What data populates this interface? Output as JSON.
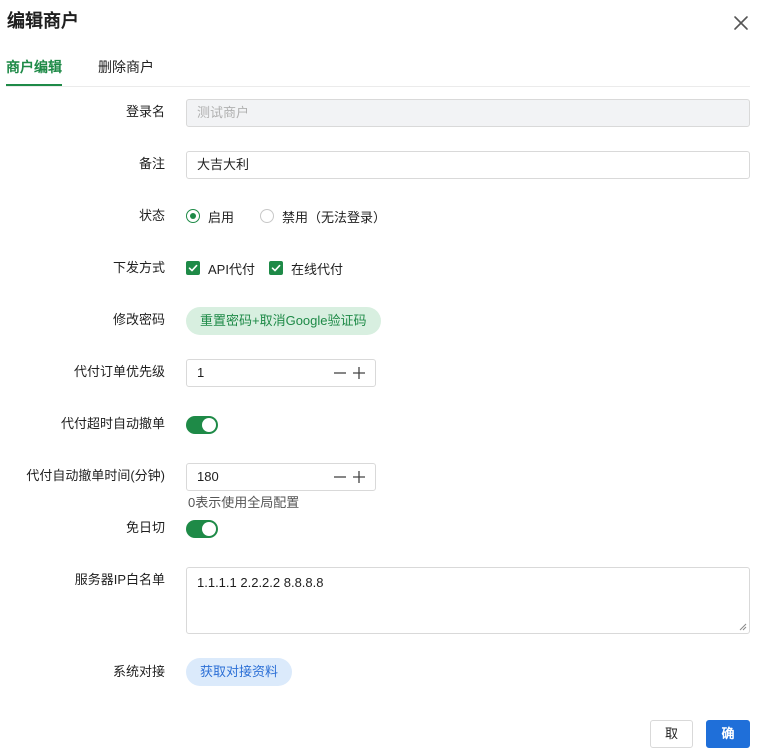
{
  "dialog": {
    "title": "编辑商户"
  },
  "tabs": [
    {
      "label": "商户编辑",
      "active": true
    },
    {
      "label": "删除商户",
      "active": false
    }
  ],
  "form": {
    "login_name": {
      "label": "登录名",
      "placeholder": "测试商户"
    },
    "remark": {
      "label": "备注",
      "value": "大吉大利"
    },
    "status": {
      "label": "状态",
      "options": [
        "启用",
        "禁用（无法登录）"
      ],
      "selected": "启用"
    },
    "dispatch": {
      "label": "下发方式",
      "options": [
        "API代付",
        "在线代付"
      ],
      "checked": [
        "API代付",
        "在线代付"
      ]
    },
    "password": {
      "label": "修改密码",
      "button": "重置密码+取消Google验证码"
    },
    "priority": {
      "label": "代付订单优先级",
      "value": "1"
    },
    "auto_cancel": {
      "label": "代付超时自动撤单",
      "on": true
    },
    "cancel_time": {
      "label": "代付自动撤单时间(分钟)",
      "value": "180",
      "hint": "0表示使用全局配置"
    },
    "no_cut": {
      "label": "免日切",
      "on": true
    },
    "ip_whitelist": {
      "label": "服务器IP白名单",
      "value": "1.1.1.1 2.2.2.2 8.8.8.8"
    },
    "integration": {
      "label": "系统对接",
      "button": "获取对接资料"
    }
  },
  "footer": {
    "cancel_label": "取消",
    "confirm_label": "确认"
  },
  "colors": {
    "primary_green": "#1e8a47",
    "primary_blue": "#1f6fd9"
  }
}
